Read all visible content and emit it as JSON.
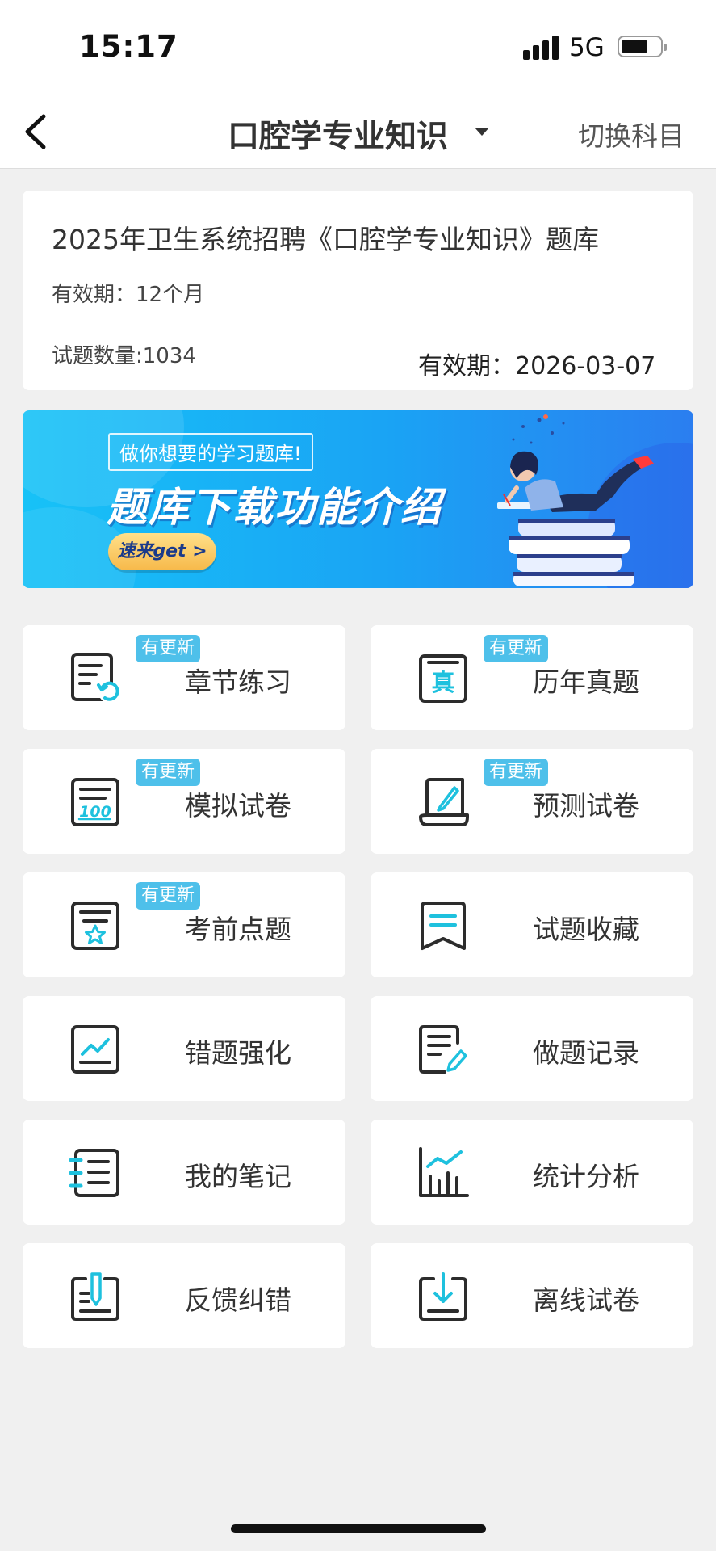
{
  "status_bar": {
    "time": "15:17",
    "network": "5G"
  },
  "nav": {
    "title": "口腔学专业知识",
    "switch_label": "切换科目"
  },
  "info": {
    "title": "2025年卫生系统招聘《口腔学专业知识》题库",
    "validity": "有效期：12个月",
    "question_count": "试题数量:1034",
    "expiry": "有效期：2026-03-07"
  },
  "banner": {
    "subtitle": "做你想要的学习题库!",
    "title": "题库下载功能介绍",
    "button": "速来get >"
  },
  "accent_color": "#1ec1de",
  "badge_color": "#4ec0ea",
  "tiles": [
    {
      "label": "章节练习",
      "badge": "有更新",
      "icon": "chapter-practice-icon"
    },
    {
      "label": "历年真题",
      "badge": "有更新",
      "icon": "past-exams-icon"
    },
    {
      "label": "模拟试卷",
      "badge": "有更新",
      "icon": "mock-exam-icon"
    },
    {
      "label": "预测试卷",
      "badge": "有更新",
      "icon": "prediction-exam-icon"
    },
    {
      "label": "考前点题",
      "badge": "有更新",
      "icon": "pre-exam-tips-icon"
    },
    {
      "label": "试题收藏",
      "icon": "favorites-icon"
    },
    {
      "label": "错题强化",
      "icon": "wrong-questions-icon"
    },
    {
      "label": "做题记录",
      "icon": "practice-record-icon"
    },
    {
      "label": "我的笔记",
      "icon": "notes-icon"
    },
    {
      "label": "统计分析",
      "icon": "statistics-icon"
    },
    {
      "label": "反馈纠错",
      "icon": "feedback-icon"
    },
    {
      "label": "离线试卷",
      "icon": "offline-exam-icon"
    }
  ]
}
